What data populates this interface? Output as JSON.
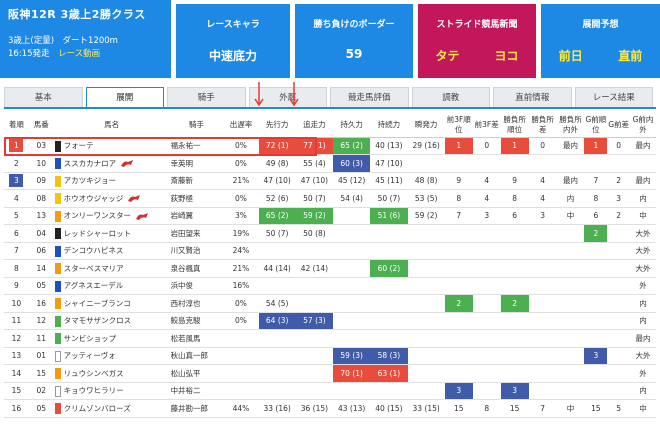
{
  "race": {
    "title": "阪神12R 3歳上2勝クラス",
    "line1": "3歳上(定量)　ダート1200m",
    "start": "16:15発走",
    "video_link": "レース動画"
  },
  "kyara": {
    "title": "レースキャラ",
    "value": "中速底力"
  },
  "border": {
    "title": "勝ち負けのボーダー",
    "value": "59"
  },
  "stride": {
    "title": "ストライド競馬新聞",
    "v1": "タテ",
    "v2": "ヨコ"
  },
  "yoso": {
    "title": "展開予想",
    "v1": "前日",
    "v2": "直前"
  },
  "tabs": [
    "基本",
    "展開",
    "騎手",
    "外厩",
    "競走馬評価",
    "調教",
    "直前情報",
    "レース結果"
  ],
  "headers": [
    "着順",
    "馬番",
    "馬名",
    "騎手",
    "出遅率",
    "先行力",
    "追走力",
    "持久力",
    "持続力",
    "瞬発力",
    "前3F順位",
    "前3F差",
    "勝負所順位",
    "勝負所差",
    "勝負所内外",
    "G前順位",
    "G前差",
    "G前内外"
  ],
  "colors": {
    "red": "#e84c3d",
    "green": "#4caf50",
    "navy": "#3f5ba9",
    "blue": "#1e88e5",
    "magenta": "#c2185b"
  },
  "rows": [
    {
      "rank": "1",
      "num": "03",
      "name": "フォーテ",
      "cap": "#222222",
      "jockey": "福永祐一",
      "late": "0%",
      "senko": "72 (1)",
      "tsuiso": "77 (1)",
      "jikyu": "65 (2)",
      "jizoku": "40 (13)",
      "shunpatsu": "29 (16)",
      "f3r": "1",
      "f3d": "0",
      "sr": "1",
      "sd": "0",
      "sio": "最内",
      "gr": "1",
      "gd": "0",
      "gio": "最内",
      "flag": false
    },
    {
      "rank": "2",
      "num": "10",
      "name": "ススカカナロア",
      "cap": "#1e4fbf",
      "jockey": "幸英明",
      "late": "0%",
      "senko": "49 (8)",
      "tsuiso": "55 (4)",
      "jikyu": "60 (3)",
      "jizoku": "47 (10)",
      "shunpatsu": "",
      "f3r": "",
      "f3d": "",
      "sr": "",
      "sd": "",
      "sio": "",
      "gr": "",
      "gd": "",
      "gio": "",
      "flag": true
    },
    {
      "rank": "3",
      "num": "09",
      "name": "アカツキジョー",
      "cap": "#f1c40f",
      "jockey": "斎藤新",
      "late": "21%",
      "senko": "47 (10)",
      "tsuiso": "47 (10)",
      "jikyu": "45 (12)",
      "jizoku": "45 (11)",
      "shunpatsu": "48 (8)",
      "f3r": "9",
      "f3d": "4",
      "sr": "9",
      "sd": "4",
      "sio": "最内",
      "gr": "7",
      "gd": "2",
      "gio": "最内",
      "flag": false
    },
    {
      "rank": "4",
      "num": "08",
      "name": "ホウオウジャッジ",
      "cap": "#f1c40f",
      "jockey": "荻野極",
      "late": "0%",
      "senko": "52 (6)",
      "tsuiso": "50 (7)",
      "jikyu": "54 (4)",
      "jizoku": "50 (7)",
      "shunpatsu": "53 (5)",
      "f3r": "8",
      "f3d": "4",
      "sr": "8",
      "sd": "4",
      "sio": "内",
      "gr": "8",
      "gd": "3",
      "gio": "内",
      "flag": true
    },
    {
      "rank": "5",
      "num": "13",
      "name": "オンリーワンスター",
      "cap": "#f39c12",
      "jockey": "岩崎翼",
      "late": "3%",
      "senko": "65 (2)",
      "tsuiso": "59 (2)",
      "jikyu": "",
      "jizoku": "51 (6)",
      "shunpatsu": "59 (2)",
      "f3r": "7",
      "f3d": "3",
      "sr": "6",
      "sd": "3",
      "sio": "中",
      "gr": "6",
      "gd": "2",
      "gio": "中",
      "flag": true
    },
    {
      "rank": "6",
      "num": "04",
      "name": "レッドシャーロット",
      "cap": "#222222",
      "jockey": "岩田望来",
      "late": "19%",
      "senko": "50 (7)",
      "tsuiso": "50 (8)",
      "jikyu": "",
      "jizoku": "",
      "shunpatsu": "",
      "f3r": "",
      "f3d": "",
      "sr": "",
      "sd": "",
      "sio": "",
      "gr": "2",
      "gd": "",
      "gio": "大外",
      "flag": false
    },
    {
      "rank": "7",
      "num": "06",
      "name": "デンコウハピネス",
      "cap": "#1e4fbf",
      "jockey": "川又賢治",
      "late": "24%",
      "senko": "",
      "tsuiso": "",
      "jikyu": "",
      "jizoku": "",
      "shunpatsu": "",
      "f3r": "",
      "f3d": "",
      "sr": "",
      "sd": "",
      "sio": "",
      "gr": "",
      "gd": "",
      "gio": "大外",
      "flag": false
    },
    {
      "rank": "8",
      "num": "14",
      "name": "スターベスマリア",
      "cap": "#f39c12",
      "jockey": "泉谷楓真",
      "late": "21%",
      "senko": "44 (14)",
      "tsuiso": "42 (14)",
      "jikyu": "",
      "jizoku": "60 (2)",
      "shunpatsu": "",
      "f3r": "",
      "f3d": "",
      "sr": "",
      "sd": "",
      "sio": "",
      "gr": "",
      "gd": "",
      "gio": "大外",
      "flag": false
    },
    {
      "rank": "9",
      "num": "05",
      "name": "アグネスエーデル",
      "cap": "#1e4fbf",
      "jockey": "浜中俊",
      "late": "16%",
      "senko": "",
      "tsuiso": "",
      "jikyu": "",
      "jizoku": "",
      "shunpatsu": "",
      "f3r": "",
      "f3d": "",
      "sr": "",
      "sd": "",
      "sio": "",
      "gr": "",
      "gd": "",
      "gio": "外",
      "flag": false
    },
    {
      "rank": "10",
      "num": "16",
      "name": "シャイニーブランコ",
      "cap": "#f39c12",
      "jockey": "西村淳也",
      "late": "0%",
      "senko": "54 (5)",
      "tsuiso": "",
      "jikyu": "",
      "jizoku": "",
      "shunpatsu": "",
      "f3r": "2",
      "f3d": "",
      "sr": "2",
      "sd": "",
      "sio": "",
      "gr": "",
      "gd": "",
      "gio": "内",
      "flag": false
    },
    {
      "rank": "11",
      "num": "12",
      "name": "タマモサザンクロス",
      "cap": "#4caf50",
      "jockey": "鮫島克駿",
      "late": "0%",
      "senko": "64 (3)",
      "tsuiso": "57 (3)",
      "jikyu": "",
      "jizoku": "",
      "shunpatsu": "",
      "f3r": "",
      "f3d": "",
      "sr": "",
      "sd": "",
      "sio": "",
      "gr": "",
      "gd": "",
      "gio": "内",
      "flag": false
    },
    {
      "rank": "12",
      "num": "11",
      "name": "サンビショップ",
      "cap": "#4caf50",
      "jockey": "松若風馬",
      "late": "",
      "senko": "",
      "tsuiso": "",
      "jikyu": "",
      "jizoku": "",
      "shunpatsu": "",
      "f3r": "",
      "f3d": "",
      "sr": "",
      "sd": "",
      "sio": "",
      "gr": "",
      "gd": "",
      "gio": "最内",
      "flag": false
    },
    {
      "rank": "13",
      "num": "01",
      "name": "アッティーヴォ",
      "cap": "#ffffff",
      "jockey": "秋山真一郎",
      "late": "",
      "senko": "",
      "tsuiso": "",
      "jikyu": "59 (3)",
      "jizoku": "58 (3)",
      "shunpatsu": "",
      "f3r": "",
      "f3d": "",
      "sr": "",
      "sd": "",
      "sio": "",
      "gr": "3",
      "gd": "",
      "gio": "大外",
      "flag": false
    },
    {
      "rank": "14",
      "num": "15",
      "name": "リュウシンベガス",
      "cap": "#f39c12",
      "jockey": "松山弘平",
      "late": "",
      "senko": "",
      "tsuiso": "",
      "jikyu": "70 (1)",
      "jizoku": "63 (1)",
      "shunpatsu": "",
      "f3r": "",
      "f3d": "",
      "sr": "",
      "sd": "",
      "sio": "",
      "gr": "",
      "gd": "",
      "gio": "外",
      "flag": false
    },
    {
      "rank": "15",
      "num": "02",
      "name": "キョウワヒラリー",
      "cap": "#ffffff",
      "jockey": "中井裕二",
      "late": "",
      "senko": "",
      "tsuiso": "",
      "jikyu": "",
      "jizoku": "",
      "shunpatsu": "",
      "f3r": "3",
      "f3d": "",
      "sr": "3",
      "sd": "",
      "sio": "",
      "gr": "",
      "gd": "",
      "gio": "内",
      "flag": false
    },
    {
      "rank": "16",
      "num": "05",
      "name": "クリムゾンバローズ",
      "cap": "#e84c3d",
      "jockey": "藤井勘一郎",
      "late": "44%",
      "senko": "33 (16)",
      "tsuiso": "36 (15)",
      "jikyu": "43 (13)",
      "jizoku": "40 (15)",
      "shunpatsu": "33 (15)",
      "f3r": "15",
      "f3d": "8",
      "sr": "15",
      "sd": "7",
      "sio": "中",
      "gr": "15",
      "gd": "5",
      "gio": "中",
      "flag": false
    }
  ]
}
